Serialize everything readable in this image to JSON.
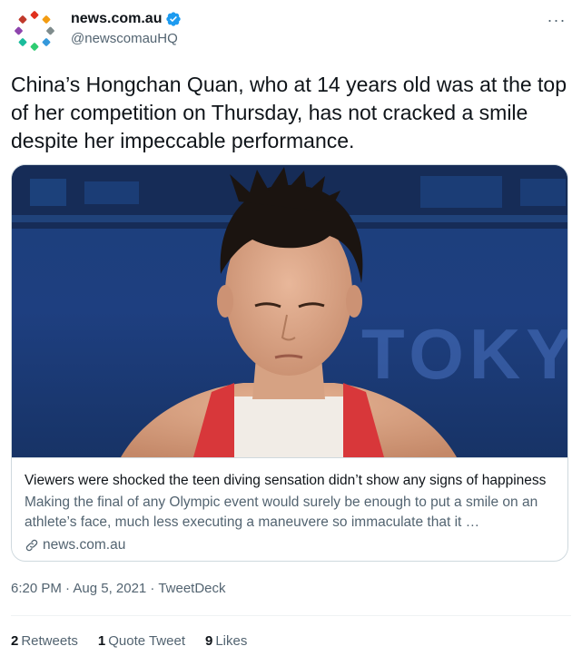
{
  "header": {
    "display_name": "news.com.au",
    "handle": "@newscomauHQ",
    "more_label": "···"
  },
  "tweet": {
    "text": "China’s Hongchan Quan, who at 14 years old was at the top of her competition on Thursday, has not cracked a smile despite her impeccable performance."
  },
  "card": {
    "image_text": "TOKY",
    "title": "Viewers were shocked the teen diving sensation didn’t show any signs of happiness",
    "description": "Making the final of any Olympic event would surely be enough to put a smile on an athlete’s face, much less executing a maneuvere so immaculate that it …",
    "domain": "news.com.au"
  },
  "meta": {
    "timestamp": "6:20 PM · Aug 5, 2021 · TweetDeck"
  },
  "stats": {
    "retweets_count": "2",
    "retweets_label": "Retweets",
    "quotes_count": "1",
    "quotes_label": "Quote Tweet",
    "likes_count": "9",
    "likes_label": "Likes"
  },
  "colors": {
    "verified": "#1d9bf0",
    "secondary_text": "#536471",
    "border": "#cfd9de"
  }
}
